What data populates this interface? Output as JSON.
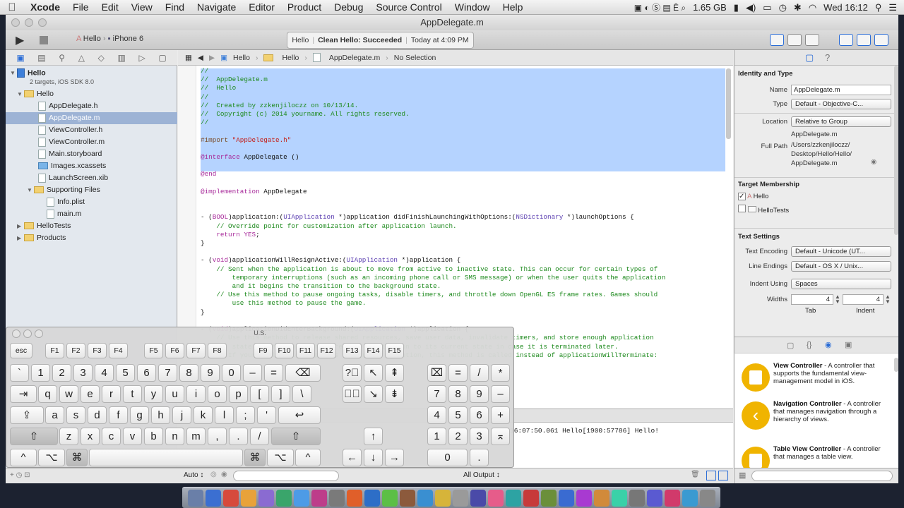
{
  "menubar": {
    "app": "Xcode",
    "items": [
      "File",
      "Edit",
      "View",
      "Find",
      "Navigate",
      "Editor",
      "Product",
      "Debug",
      "Source Control",
      "Window",
      "Help"
    ],
    "memory": "1.65 GB",
    "clock": "Wed 16:12"
  },
  "window": {
    "title": "AppDelegate.m"
  },
  "toolbar": {
    "scheme_target": "Hello",
    "scheme_device": "iPhone 6",
    "activity_project": "Hello",
    "activity_status": "Clean Hello: Succeeded",
    "activity_time": "Today at 4:09 PM"
  },
  "navigator": {
    "project": "Hello",
    "project_sub": "2 targets, iOS SDK 8.0",
    "group": "Hello",
    "files": [
      "AppDelegate.h",
      "AppDelegate.m",
      "ViewController.h",
      "ViewController.m",
      "Main.storyboard",
      "Images.xcassets",
      "LaunchScreen.xib"
    ],
    "supporting": "Supporting Files",
    "supporting_files": [
      "Info.plist",
      "main.m"
    ],
    "other_groups": [
      "HelloTests",
      "Products"
    ]
  },
  "jumpbar": {
    "crumbs": [
      "Hello",
      "Hello",
      "AppDelegate.m",
      "No Selection"
    ]
  },
  "console": {
    "log": "16:07:50.061 Hello[1900:57786] Hello!"
  },
  "bottombar": {
    "auto": "Auto ↕",
    "output": "All Output ↕"
  },
  "inspector": {
    "identity_title": "Identity and Type",
    "name_label": "Name",
    "name_value": "AppDelegate.m",
    "type_label": "Type",
    "type_value": "Default - Objective-C...",
    "location_label": "Location",
    "location_value": "Relative to Group",
    "location_file": "AppDelegate.m",
    "fullpath_label": "Full Path",
    "fullpath_lines": [
      "/Users/zzkenjiloczz/",
      "Desktop/Hello/Hello/",
      "AppDelegate.m"
    ],
    "target_title": "Target Membership",
    "targets": [
      {
        "name": "Hello",
        "checked": true
      },
      {
        "name": "HelloTests",
        "checked": false
      }
    ],
    "text_title": "Text Settings",
    "encoding_label": "Text Encoding",
    "encoding_value": "Default - Unicode (UT...",
    "lineend_label": "Line Endings",
    "lineend_value": "Default - OS X / Unix...",
    "indent_label": "Indent Using",
    "indent_value": "Spaces",
    "widths_label": "Widths",
    "tab_value": "4",
    "indent_width_value": "4",
    "tab_caption": "Tab",
    "indent_caption": "Indent"
  },
  "library": [
    {
      "name": "View Controller",
      "desc": " - A controller that supports the fundamental view-management model in iOS."
    },
    {
      "name": "Navigation Controller",
      "desc": " - A controller that manages navigation through a hierarchy of views."
    },
    {
      "name": "Table View Controller",
      "desc": " - A controller that manages a table view."
    }
  ],
  "keyboard": {
    "title": "U.S.",
    "fn_row": [
      "esc",
      "F1",
      "F2",
      "F3",
      "F4",
      "F5",
      "F6",
      "F7",
      "F8",
      "F9",
      "F10",
      "F11",
      "F12",
      "F13",
      "F14",
      "F15"
    ],
    "num_row": [
      "`",
      "1",
      "2",
      "3",
      "4",
      "5",
      "6",
      "7",
      "8",
      "9",
      "0",
      "–",
      "=",
      "⌫"
    ],
    "q_row": [
      "⇥",
      "q",
      "w",
      "e",
      "r",
      "t",
      "y",
      "u",
      "i",
      "o",
      "p",
      "[",
      "]",
      "\\"
    ],
    "a_row": [
      "⇪",
      "a",
      "s",
      "d",
      "f",
      "g",
      "h",
      "j",
      "k",
      "l",
      ";",
      "'",
      "↩"
    ],
    "z_row": [
      "⇧",
      "z",
      "x",
      "c",
      "v",
      "b",
      "n",
      "m",
      ",",
      ".",
      "/",
      "⇧"
    ],
    "bottom_row": [
      "^",
      "⌥",
      "⌘",
      "",
      "⌘",
      "⌥",
      "^"
    ],
    "nav_keys": [
      "?⃝",
      "↖",
      "⇞",
      "⌦⃝",
      "↘",
      "⇟",
      "↑",
      "←",
      "↓",
      "→"
    ],
    "numpad": [
      "⌧",
      "=",
      "/",
      "*",
      "7",
      "8",
      "9",
      "–",
      "4",
      "5",
      "6",
      "+",
      "1",
      "2",
      "3",
      "⌅",
      "0",
      "."
    ]
  }
}
